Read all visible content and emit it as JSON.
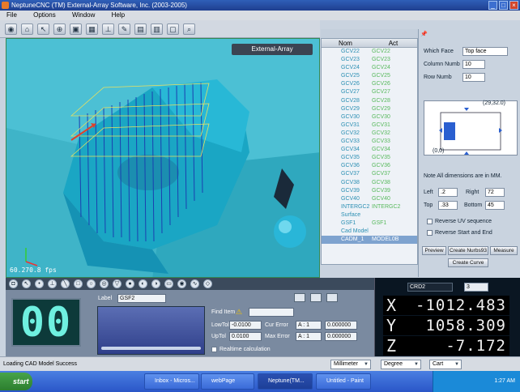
{
  "window": {
    "title": "NeptuneCNC (TM) External-Array Software, Inc. (2003-2005)"
  },
  "menu": [
    "File",
    "Options",
    "Window",
    "Help"
  ],
  "toolbar_icons": [
    "view-icon",
    "home-icon",
    "cursor-icon",
    "target-icon",
    "fit-icon",
    "grid-icon",
    "axes-icon",
    "tool-icon",
    "paint-icon",
    "doc-icon",
    "file-icon",
    "zoom-icon"
  ],
  "viewport": {
    "brand": "External-Array",
    "fps": "60.270.8 fps"
  },
  "list": {
    "headers": [
      "Nom",
      "Act"
    ],
    "rows": [
      [
        "GCV22",
        "GCV22"
      ],
      [
        "GCV23",
        "GCV23"
      ],
      [
        "GCV24",
        "GCV24"
      ],
      [
        "GCV25",
        "GCV25"
      ],
      [
        "GCV26",
        "GCV26"
      ],
      [
        "GCV27",
        "GCV27"
      ],
      [
        "GCV28",
        "GCV28"
      ],
      [
        "GCV29",
        "GCV29"
      ],
      [
        "GCV30",
        "GCV30"
      ],
      [
        "GCV31",
        "GCV31"
      ],
      [
        "GCV32",
        "GCV32"
      ],
      [
        "GCV33",
        "GCV33"
      ],
      [
        "GCV34",
        "GCV34"
      ],
      [
        "GCV35",
        "GCV35"
      ],
      [
        "GCV36",
        "GCV36"
      ],
      [
        "GCV37",
        "GCV37"
      ],
      [
        "GCV38",
        "GCV38"
      ],
      [
        "GCV39",
        "GCV39"
      ],
      [
        "GCV40",
        "GCV40"
      ],
      [
        "INTERGC2",
        "INTERGC2"
      ]
    ],
    "surface": "Surface",
    "gsf": [
      "GSF1",
      "GSF1"
    ],
    "cad": "Cad Model",
    "selected": [
      "CADM_1",
      "MODEL0B"
    ]
  },
  "right": {
    "which_face_label": "Which Face",
    "which_face_value": "Top face",
    "col_label": "Column Numb",
    "col_value": "10",
    "row_label": "Row Numb",
    "row_value": "10",
    "coord_top": "(29,32.0)",
    "coord_origin": "(0,0)",
    "note": "Note All dimensions are in MM.",
    "left_label": "Left",
    "left_value": ".2",
    "right_label": "Right",
    "right_value": "72",
    "top_label": "Top",
    "top_value": ".33",
    "bottom_label": "Bottom",
    "bottom_value": "45",
    "rev_uv": "Reverse UV sequence",
    "rev_se": "Reverse Start and End",
    "btn_preview": "Preview",
    "btn_create_nurbs": "Create Nurbs93",
    "btn_measure": "Measure",
    "btn_create_curve": "Create Curve"
  },
  "bottom": {
    "segment": "00",
    "label_label": "Label",
    "label_value": "GSF2",
    "find_item": "Find Item",
    "low_tol_label": "LowTol",
    "low_tol_value": "-0.0100",
    "up_tol_label": "UpTol",
    "up_tol_value": "0.0100",
    "cur_error_label": "Cur Error",
    "cur_error_a": "A : 1",
    "cur_error_v": "0.000000",
    "max_error_label": "Max Error",
    "max_error_a": "A : 1",
    "max_error_v": "0.000000",
    "realtime": "Realtime calculation"
  },
  "dro": {
    "name": "CRD2",
    "num": "3",
    "x_axis": "X",
    "x": "-1012.483",
    "y_axis": "Y",
    "y": "1058.309",
    "z_axis": "Z",
    "z": "-7.172"
  },
  "status": {
    "message": "Loading CAD Model Success",
    "unit": "Millimeter",
    "angle": "Degree",
    "coord": "Cart"
  },
  "taskbar": {
    "start": "start",
    "tasks": [
      "Inbox - Micros...",
      "webPage",
      "Neptune(TM...",
      "Untitled - Paint"
    ],
    "clock": "1:27 AM"
  },
  "colors": {
    "viewport": "#4cc0d4",
    "dro_text": "#f0f0f0",
    "segment": "#6ff0e0"
  }
}
